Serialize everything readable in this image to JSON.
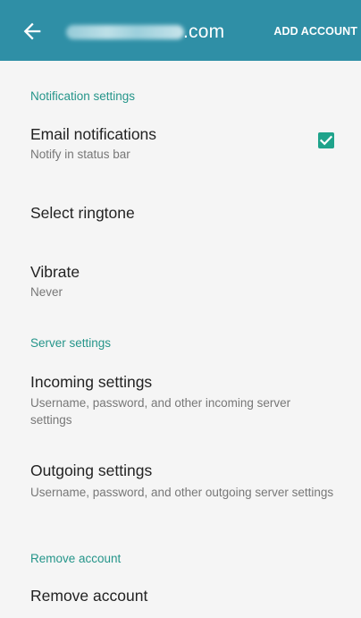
{
  "appbar": {
    "domain_suffix": ".com",
    "add_account_label": "ADD ACCOUNT"
  },
  "notification": {
    "section_title": "Notification settings",
    "email_title": "Email notifications",
    "email_sub": "Notify in status bar",
    "email_checked": true,
    "ringtone_title": "Select ringtone",
    "vibrate_title": "Vibrate",
    "vibrate_sub": "Never"
  },
  "server": {
    "section_title": "Server settings",
    "incoming_title": "Incoming settings",
    "incoming_sub": "Username, password, and other incoming server settings",
    "outgoing_title": "Outgoing settings",
    "outgoing_sub": "Username, password, and other outgoing server settings"
  },
  "remove": {
    "section_title": "Remove account",
    "remove_title": "Remove account"
  },
  "colors": {
    "appbar": "#2f8fa6",
    "accent": "#25958a",
    "checkbox": "#1fa38b"
  }
}
